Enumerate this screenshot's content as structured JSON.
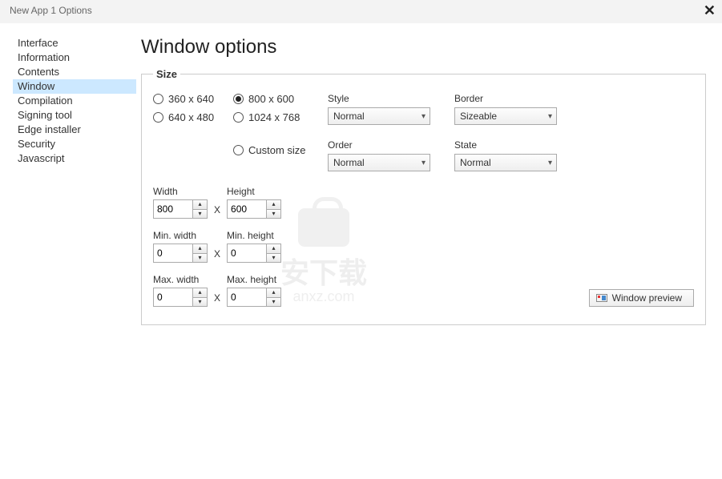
{
  "titlebar": {
    "title": "New App 1 Options"
  },
  "sidebar": {
    "items": [
      {
        "label": "Interface"
      },
      {
        "label": "Information"
      },
      {
        "label": "Contents"
      },
      {
        "label": "Window"
      },
      {
        "label": "Compilation"
      },
      {
        "label": "Signing tool"
      },
      {
        "label": "Edge installer"
      },
      {
        "label": "Security"
      },
      {
        "label": "Javascript"
      }
    ],
    "selected_index": 3
  },
  "page": {
    "title": "Window options"
  },
  "size": {
    "legend": "Size",
    "radios": {
      "r360": "360 x 640",
      "r640": "640 x 480",
      "r800": "800 x 600",
      "r1024": "1024 x 768",
      "custom": "Custom size"
    },
    "selected_radio": "r800",
    "width_label": "Width",
    "height_label": "Height",
    "minw_label": "Min. width",
    "minh_label": "Min. height",
    "maxw_label": "Max. width",
    "maxh_label": "Max. height",
    "width": "800",
    "height": "600",
    "minw": "0",
    "minh": "0",
    "maxw": "0",
    "maxh": "0",
    "x": "X"
  },
  "combos": {
    "style_label": "Style",
    "border_label": "Border",
    "order_label": "Order",
    "state_label": "State",
    "style": "Normal",
    "border": "Sizeable",
    "order": "Normal",
    "state": "Normal"
  },
  "buttons": {
    "preview": "Window preview"
  },
  "watermark": {
    "txt1": "安下载",
    "txt2": "anxz.com"
  }
}
